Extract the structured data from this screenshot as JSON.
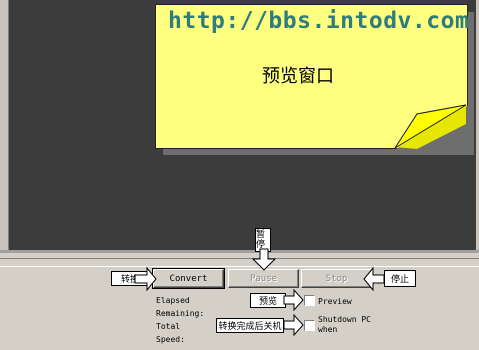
{
  "preview_note": {
    "url": "http://bbs.intodv.com",
    "title": "预览窗口",
    "color": "#ffff80"
  },
  "buttons": {
    "convert": "Convert",
    "pause": "Pause",
    "stop": "Stop"
  },
  "status_labels": {
    "elapsed": "Elapsed",
    "remaining": "Remaining:",
    "total": "Total",
    "speed": "Speed:"
  },
  "options": {
    "preview": "Preview",
    "shutdown_line1": "Shutdown PC",
    "shutdown_line2": "when"
  },
  "annotations": {
    "convert": "转换",
    "pause": "暂停",
    "stop": "停止",
    "preview": "预览",
    "shutdown": "转换完成后关机"
  }
}
